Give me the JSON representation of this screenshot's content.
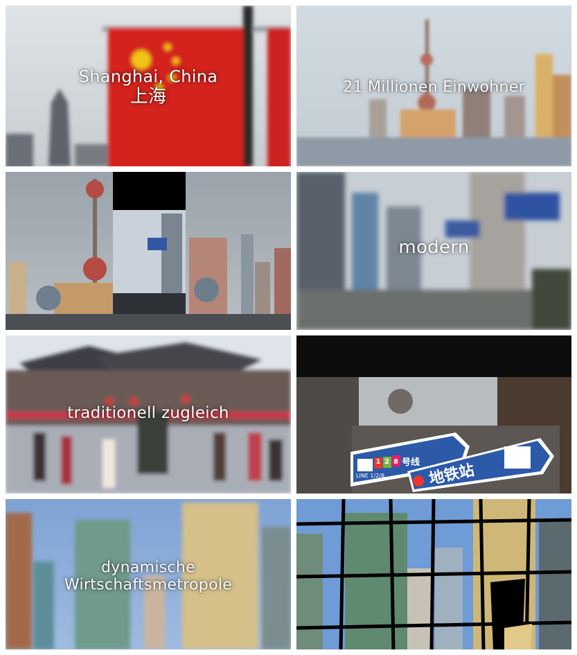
{
  "frames": [
    {
      "id": "shanghai-china",
      "caption_lines": [
        "Shanghai, China",
        "上海"
      ]
    },
    {
      "id": "population",
      "caption_lines": [
        "21 Millionen Einwohner"
      ]
    },
    {
      "id": "transition-collage",
      "caption_lines": []
    },
    {
      "id": "modern",
      "caption_lines": [
        "modern"
      ]
    },
    {
      "id": "traditional",
      "caption_lines": [
        "traditionell zugleich"
      ]
    },
    {
      "id": "metro-street",
      "caption_lines": [],
      "sign_text": {
        "line": "LINE 1/2/8",
        "station": "地铁站",
        "numbers": [
          "1",
          "2",
          "8"
        ],
        "hao": "号线"
      }
    },
    {
      "id": "dynamic-metropolis",
      "caption_lines": [
        "dynamische",
        "Wirtschaftsmetropole"
      ]
    },
    {
      "id": "shattered-towers",
      "caption_lines": []
    }
  ],
  "colors": {
    "flag_red": "#d4201c",
    "flag_star": "#f2c318",
    "sky_blue": "#7fa6d6",
    "sign_blue": "#2c5aa8"
  }
}
